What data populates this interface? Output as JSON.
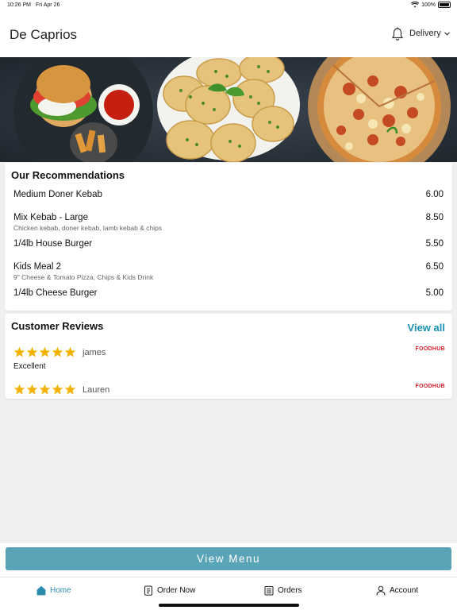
{
  "status": {
    "time": "10:26 PM",
    "date": "Fri Apr 26",
    "battery": "100%"
  },
  "header": {
    "title": "De Caprios",
    "mode": "Delivery"
  },
  "recommendations": {
    "title": "Our Recommendations",
    "items": [
      {
        "name": "Medium Doner Kebab",
        "desc": "",
        "price": "6.00"
      },
      {
        "name": "Mix Kebab - Large",
        "desc": "Chicken kebab, doner kebab, lamb kebab & chips",
        "price": "8.50"
      },
      {
        "name": "1/4lb House Burger",
        "desc": "",
        "price": "5.50"
      },
      {
        "name": "Kids Meal 2",
        "desc": "9\" Cheese & Tomato Pizza, Chips & Kids Drink",
        "price": "6.50"
      },
      {
        "name": "1/4lb Cheese Burger",
        "desc": "",
        "price": "5.00"
      }
    ]
  },
  "reviews": {
    "title": "Customer Reviews",
    "view_all": "View all",
    "items": [
      {
        "name": "james",
        "text": "Excellent",
        "rating": 5,
        "source": "FOODHUB"
      },
      {
        "name": "Lauren",
        "text": "",
        "rating": 5,
        "source": "FOODHUB"
      }
    ]
  },
  "cta": {
    "label": "View Menu"
  },
  "tabs": [
    {
      "label": "Home",
      "icon": "home-icon",
      "active": true
    },
    {
      "label": "Order Now",
      "icon": "order-icon",
      "active": false
    },
    {
      "label": "Orders",
      "icon": "orders-icon",
      "active": false
    },
    {
      "label": "Account",
      "icon": "account-icon",
      "active": false
    }
  ],
  "colors": {
    "accent": "#5aa4b8",
    "link": "#1a8fb0",
    "star": "#f5b301",
    "brand": "#d41e2a"
  }
}
